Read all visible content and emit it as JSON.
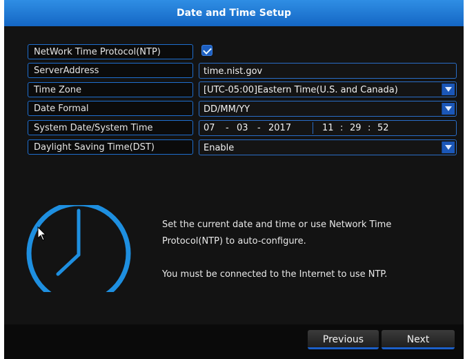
{
  "window": {
    "title": "Date and Time Setup"
  },
  "rows": {
    "ntp": {
      "label": "NetWork Time Protocol(NTP)",
      "checked": true
    },
    "server": {
      "label": "ServerAddress",
      "value": "time.nist.gov"
    },
    "timezone": {
      "label": "Time Zone",
      "value": "[UTC-05:00]Eastern Time(U.S. and Canada)"
    },
    "dateformat": {
      "label": "Date Formal",
      "value": "DD/MM/YY"
    },
    "datetime": {
      "label": "System Date/System Time",
      "day": "07",
      "sep1": "-",
      "month": "03",
      "sep2": "-",
      "year": "2017",
      "hour": "11",
      "tsep1": ":",
      "minute": "29",
      "tsep2": ":",
      "second": "52"
    },
    "dst": {
      "label": "Daylight Saving Time(DST)",
      "value": "Enable"
    }
  },
  "info": {
    "line1": "Set the current date and time or use Network Time",
    "line2": "Protocol(NTP) to auto-configure.",
    "line3": "You must be connected to the Internet to use NTP."
  },
  "buttons": {
    "previous": "Previous",
    "next": "Next"
  },
  "icons": {
    "clock": "clock-icon",
    "dropdown": "chevron-down-icon",
    "checkbox": "checkmark-icon",
    "cursor": "mouse-pointer-icon"
  },
  "colors": {
    "accent": "#1466c4",
    "clock": "#1e8fe0",
    "border": "#1f6fd0"
  }
}
